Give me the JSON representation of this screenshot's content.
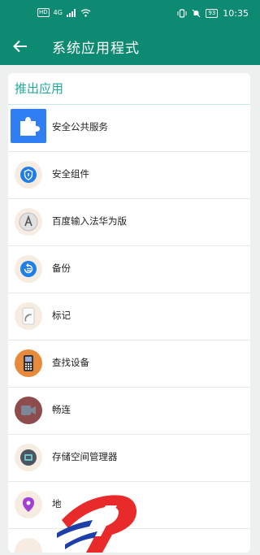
{
  "status_bar": {
    "hd_label": "HD",
    "signal_label": "4G",
    "battery": "93",
    "time": "10:35"
  },
  "appbar": {
    "title": "系统应用程式"
  },
  "section": {
    "title": "推出应用"
  },
  "apps": [
    {
      "label": "安全公共服务",
      "icon": "puzzle-icon"
    },
    {
      "label": "安全组件",
      "icon": "shield-icon"
    },
    {
      "label": "百度输入法华为版",
      "icon": "keyboard-a-icon"
    },
    {
      "label": "备份",
      "icon": "backup-icon"
    },
    {
      "label": "标记",
      "icon": "tag-icon"
    },
    {
      "label": "查找设备",
      "icon": "phone-icon"
    },
    {
      "label": "畅连",
      "icon": "video-call-icon"
    },
    {
      "label": "存储空间管理器",
      "icon": "storage-icon"
    },
    {
      "label": "地",
      "icon": "location-icon"
    }
  ],
  "colors": {
    "primary": "#0d8a72",
    "accent": "#22a99d"
  }
}
